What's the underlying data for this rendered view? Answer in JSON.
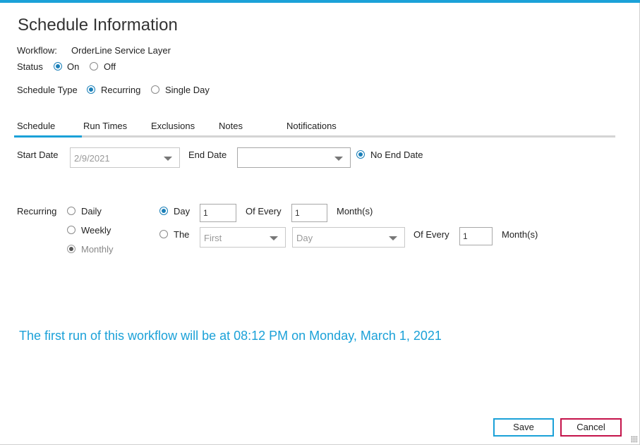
{
  "title": "Schedule Information",
  "workflow": {
    "label": "Workflow:",
    "value": "OrderLine Service Layer"
  },
  "status": {
    "label": "Status",
    "options": [
      "On",
      "Off"
    ],
    "selected": "On"
  },
  "schedule_type": {
    "label": "Schedule Type",
    "options": [
      "Recurring",
      "Single Day"
    ],
    "selected": "Recurring"
  },
  "tabs": [
    "Schedule",
    "Run Times",
    "Exclusions",
    "Notes",
    "Notifications"
  ],
  "active_tab": "Schedule",
  "dates": {
    "start_label": "Start Date",
    "start_value": "2/9/2021",
    "end_label": "End Date",
    "end_value": "",
    "no_end_label": "No End Date",
    "no_end_checked": true
  },
  "recurring": {
    "label": "Recurring",
    "frequency_options": [
      "Daily",
      "Weekly",
      "Monthly"
    ],
    "frequency_selected": "Monthly",
    "day_option": {
      "label": "Day",
      "day_value": "1",
      "of_every_label": "Of Every",
      "months_value": "1",
      "months_label": "Month(s)",
      "selected": true
    },
    "the_option": {
      "label": "The",
      "ordinal_value": "First",
      "day_value": "Day",
      "of_every_label": "Of Every",
      "months_value": "1",
      "months_label": "Month(s)",
      "selected": false
    }
  },
  "info_message": "The first run of this workflow will be at 08:12 PM on Monday, March 1, 2021",
  "buttons": {
    "save": "Save",
    "cancel": "Cancel"
  },
  "colors": {
    "accent": "#1ba1d8",
    "cancel_border": "#c4134a",
    "radio_selected": "#1a7fb8"
  }
}
